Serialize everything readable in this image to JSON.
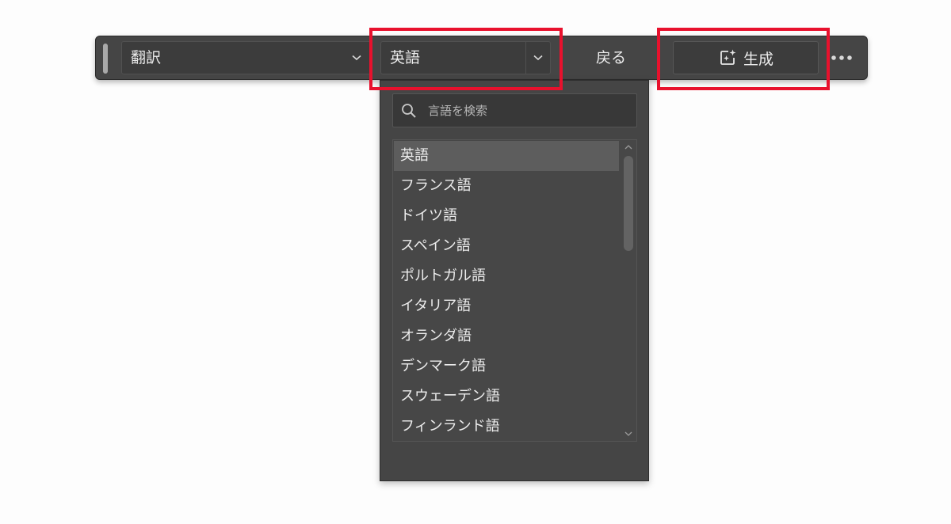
{
  "toolbar": {
    "mode_label": "翻訳",
    "language_label": "英語",
    "back_label": "戻る",
    "generate_label": "生成"
  },
  "language_popup": {
    "search_placeholder": "言語を検索",
    "items": [
      {
        "label": "英語",
        "selected": true
      },
      {
        "label": "フランス語"
      },
      {
        "label": "ドイツ語"
      },
      {
        "label": "スペイン語"
      },
      {
        "label": "ポルトガル語"
      },
      {
        "label": "イタリア語"
      },
      {
        "label": "オランダ語"
      },
      {
        "label": "デンマーク語"
      },
      {
        "label": "スウェーデン語"
      },
      {
        "label": "フィンランド語"
      }
    ]
  },
  "icons": {
    "chevron": "chevron-down-icon",
    "generate": "sparkle-edit-icon",
    "more": "more-horizontal-icon",
    "search": "search-icon"
  },
  "colors": {
    "highlight": "#e8112d",
    "panel": "#454545",
    "selected_row": "#5d5d5d"
  }
}
